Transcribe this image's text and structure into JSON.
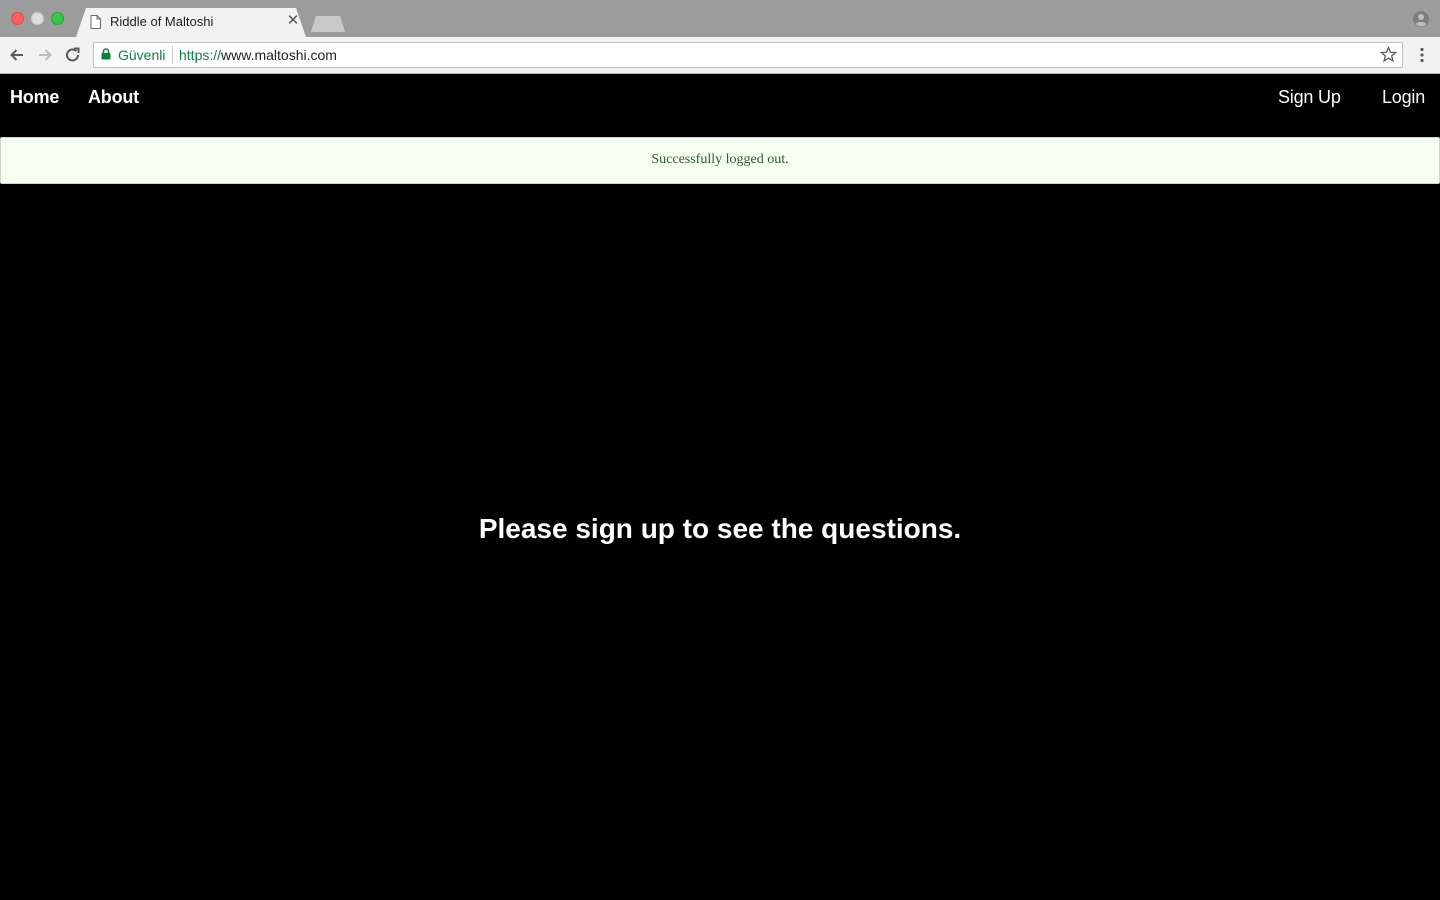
{
  "browser": {
    "tab_title": "Riddle of Maltoshi",
    "secure_label": "Güvenli",
    "url_scheme": "https://",
    "url_host": "www.maltoshi.com",
    "icons": {
      "close": "close-icon",
      "back": "back-arrow-icon",
      "forward": "forward-arrow-icon",
      "reload": "reload-icon",
      "lock": "lock-icon",
      "bookmark": "star-icon",
      "menu": "kebab-menu-icon",
      "profile": "profile-icon"
    }
  },
  "site": {
    "nav": {
      "home": "Home",
      "about": "About",
      "signup": "Sign Up",
      "login": "Login"
    },
    "flash_message": "Successfully logged out.",
    "main_message": "Please sign up to see the questions.",
    "colors": {
      "background": "#000000",
      "nav_text": "#ffffff",
      "flash_bg": "#f6fff0",
      "flash_text": "#2f5a2b",
      "secure_green": "#0b8043"
    }
  }
}
